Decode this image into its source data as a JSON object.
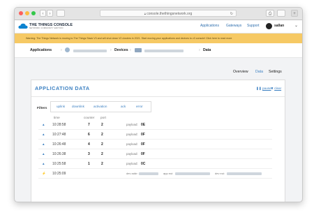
{
  "browser": {
    "url": "console.thethingsnetwork.org",
    "back": "‹",
    "forward": "›",
    "reload": "↻",
    "share": "⎙",
    "newtab": "+",
    "traffic_colors": [
      "#fc605c",
      "#fdbc40",
      "#34c84a"
    ]
  },
  "header": {
    "logo_line1": "THE THINGS  CONSOLE",
    "logo_line2": "NETWORK  COMMUNITY EDITION",
    "nav": [
      "Applications",
      "Gateways",
      "Support"
    ],
    "username": "sallan",
    "dropdown_icon": "chevron-down-icon"
  },
  "warning": {
    "text": "Warning: The Things Network is moving to The Things Stack V3 and will shut down V2 clusters in 2021. Start moving your applications and devices to v3 console! Click here to read more"
  },
  "breadcrumb": {
    "applications": "Applications",
    "sep": "›",
    "devices": "Devices",
    "data": "Data"
  },
  "subtabs": [
    "Overview",
    "Data",
    "Settings"
  ],
  "panel": {
    "title": "APPLICATION DATA",
    "pause": "pause",
    "clear": "clear",
    "filters_label": "Filters",
    "filter_tabs": [
      "uplink",
      "downlink",
      "activation",
      "ack",
      "error"
    ],
    "columns": [
      "time",
      "counter",
      "port"
    ]
  },
  "rows": [
    {
      "arrow": "▲",
      "time": "10:28:58",
      "counter": "7",
      "port": "2",
      "payload_label": "payload:",
      "payload": "0E"
    },
    {
      "arrow": "▲",
      "time": "10:27:48",
      "counter": "6",
      "port": "2",
      "payload_label": "payload:",
      "payload": "0F"
    },
    {
      "arrow": "▲",
      "time": "10:26:48",
      "counter": "4",
      "port": "2",
      "payload_label": "payload:",
      "payload": "0F"
    },
    {
      "arrow": "▲",
      "time": "10:26:38",
      "counter": "3",
      "port": "2",
      "payload_label": "payload:",
      "payload": "0F"
    },
    {
      "arrow": "▲",
      "time": "10:25:58",
      "counter": "1",
      "port": "2",
      "payload_label": "payload:",
      "payload": "0C"
    }
  ],
  "activation_row": {
    "arrow": "⚡",
    "time": "10:25:09",
    "dev_addr_label": "dev addr:",
    "app_eui_label": "app eui:",
    "dev_eui_label": "dev eui:"
  }
}
